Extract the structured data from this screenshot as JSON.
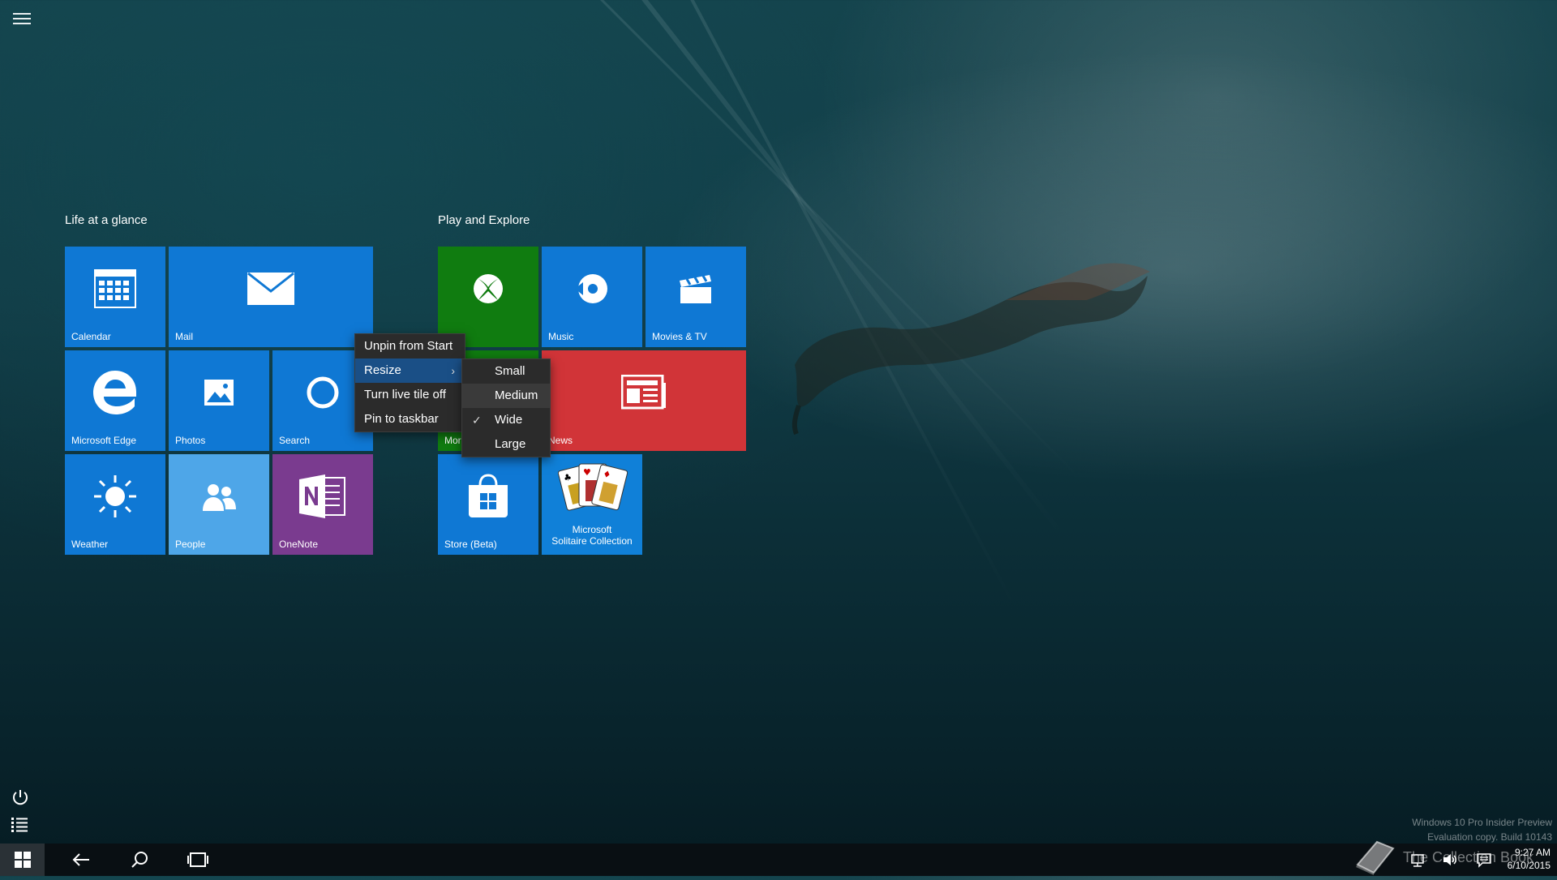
{
  "start_menu": {
    "groups": [
      {
        "title": "Life at a glance"
      },
      {
        "title": "Play and Explore"
      }
    ],
    "tiles": {
      "calendar": "Calendar",
      "mail": "Mail",
      "edge": "Microsoft Edge",
      "photos": "Photos",
      "search": "Search",
      "weather": "Weather",
      "people": "People",
      "onenote": "OneNote",
      "xbox": "",
      "music": "Music",
      "movies": "Movies & TV",
      "money": "Mor",
      "news": "News",
      "store": "Store (Beta)",
      "solitaire_line1": "Microsoft",
      "solitaire_line2": "Solitaire Collection"
    }
  },
  "context_menu": {
    "items": [
      "Unpin from Start",
      "Resize",
      "Turn live tile off",
      "Pin to taskbar"
    ],
    "highlighted": "Resize"
  },
  "resize_submenu": {
    "items": [
      "Small",
      "Medium",
      "Wide",
      "Large"
    ],
    "checked": "Wide",
    "hovered": "Medium"
  },
  "taskbar": {
    "time": "9:27 AM",
    "date": "6/10/2015"
  },
  "watermark": {
    "line1": "Windows 10 Pro Insider Preview",
    "line2": "Evaluation copy. Build 10143",
    "overlay": "The Collection Book"
  },
  "icons": {
    "menu": "hamburger-icon",
    "power": "power-icon",
    "all_apps": "all-apps-icon",
    "start": "windows-logo-icon",
    "back": "back-arrow-icon",
    "search": "search-icon",
    "task_view": "task-view-icon",
    "network": "network-icon",
    "volume": "volume-icon",
    "action_center": "action-center-icon"
  },
  "colors": {
    "tile_blue": "#0f78d4",
    "tile_green": "#107c10",
    "tile_red": "#d13438",
    "tile_purple": "#7a3b8f",
    "tile_lightblue": "#4ea6e8",
    "menu_bg": "#2b2b2b",
    "menu_highlight": "#1a4f86"
  }
}
